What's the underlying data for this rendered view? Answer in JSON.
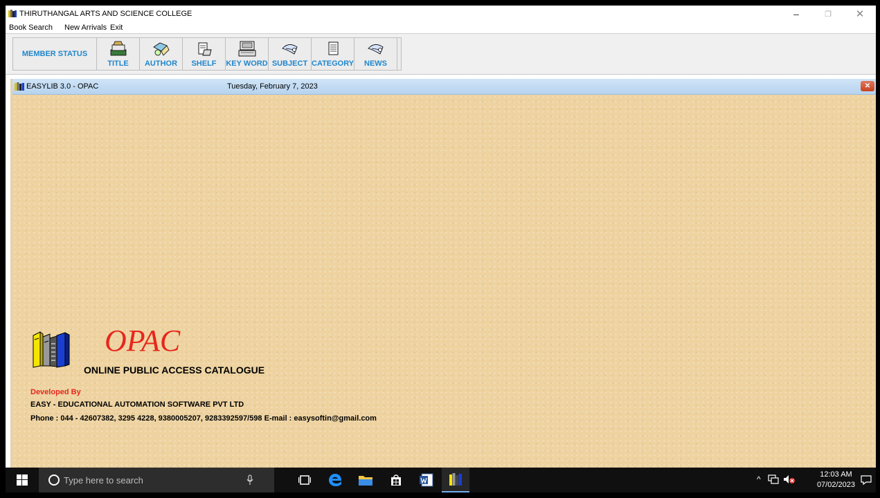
{
  "app": {
    "title": "THIRUTHANGAL ARTS AND SCIENCE COLLEGE",
    "controls": {
      "minimize": "–",
      "maximize": "❐",
      "close": "✕"
    }
  },
  "menu": [
    "Book Search",
    "New Arrivals",
    "Exit"
  ],
  "toolbar": {
    "member_status": "MEMBER STATUS",
    "buttons": [
      {
        "label": "TITLE",
        "icon": "title-icon"
      },
      {
        "label": "AUTHOR",
        "icon": "author-icon"
      },
      {
        "label": "SHELF",
        "icon": "shelf-icon"
      },
      {
        "label": "KEY WORD",
        "icon": "keyword-icon"
      },
      {
        "label": "SUBJECT",
        "icon": "subject-icon"
      },
      {
        "label": "CATEGORY",
        "icon": "category-icon"
      },
      {
        "label": "NEWS",
        "icon": "news-icon"
      }
    ]
  },
  "window": {
    "title": "EASYLIB 3.0 - OPAC",
    "date": "Tuesday, February 7, 2023",
    "close": "✕"
  },
  "splash": {
    "heading": "OPAC",
    "subtitle": "ONLINE PUBLIC ACCESS CATALOGUE",
    "developed_by": "Developed By",
    "company": "EASY - EDUCATIONAL AUTOMATION SOFTWARE PVT LTD",
    "contact": "Phone : 044 - 42607382, 3295 4228, 9380005207, 9283392597/598   E-mail : easysoftin@gmail.com"
  },
  "taskbar": {
    "search_placeholder": "Type here to search",
    "time": "12:03 AM",
    "date": "07/02/2023"
  },
  "colors": {
    "accent_blue": "#1f86cc",
    "opac_red": "#e6271c",
    "parchment": "#eed3a1"
  }
}
